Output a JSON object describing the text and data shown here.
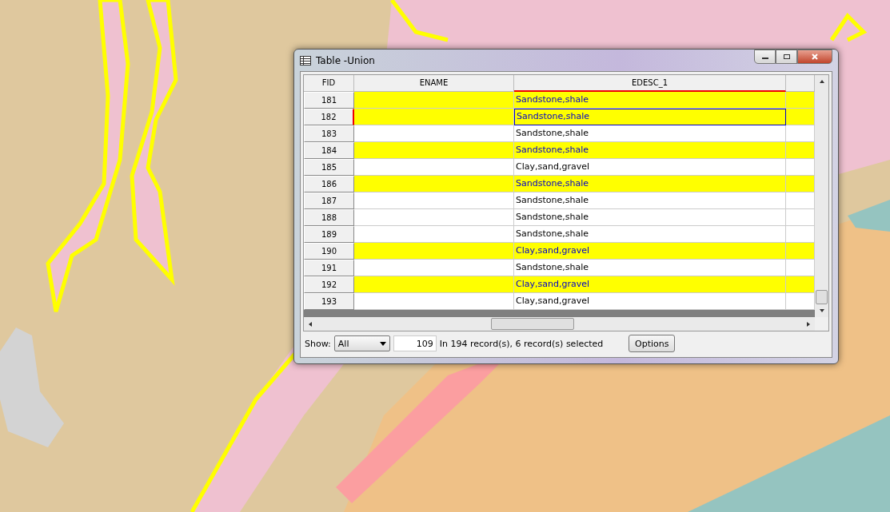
{
  "window": {
    "title": "Table -Union"
  },
  "table": {
    "columns": [
      "FID",
      "ENAME",
      "EDESC_1"
    ],
    "rows": [
      {
        "fid": "181",
        "ename": "",
        "edesc": "Sandstone,shale",
        "selected": true,
        "current": false
      },
      {
        "fid": "182",
        "ename": "",
        "edesc": "Sandstone,shale",
        "selected": true,
        "current": true
      },
      {
        "fid": "183",
        "ename": "",
        "edesc": "Sandstone,shale",
        "selected": false,
        "current": false
      },
      {
        "fid": "184",
        "ename": "",
        "edesc": "Sandstone,shale",
        "selected": true,
        "current": false
      },
      {
        "fid": "185",
        "ename": "",
        "edesc": "Clay,sand,gravel",
        "selected": false,
        "current": false
      },
      {
        "fid": "186",
        "ename": "",
        "edesc": "Sandstone,shale",
        "selected": true,
        "current": false
      },
      {
        "fid": "187",
        "ename": "",
        "edesc": "Sandstone,shale",
        "selected": false,
        "current": false
      },
      {
        "fid": "188",
        "ename": "",
        "edesc": "Sandstone,shale",
        "selected": false,
        "current": false
      },
      {
        "fid": "189",
        "ename": "",
        "edesc": "Sandstone,shale",
        "selected": false,
        "current": false
      },
      {
        "fid": "190",
        "ename": "",
        "edesc": "Clay,sand,gravel",
        "selected": true,
        "current": false
      },
      {
        "fid": "191",
        "ename": "",
        "edesc": "Sandstone,shale",
        "selected": false,
        "current": false
      },
      {
        "fid": "192",
        "ename": "",
        "edesc": "Clay,sand,gravel",
        "selected": true,
        "current": false
      },
      {
        "fid": "193",
        "ename": "",
        "edesc": "Clay,sand,gravel",
        "selected": false,
        "current": false
      }
    ]
  },
  "footer": {
    "show_label": "Show:",
    "show_value": "All",
    "record_number": "109",
    "status": "In 194 record(s), 6 record(s) selected",
    "options_button": "Options"
  }
}
